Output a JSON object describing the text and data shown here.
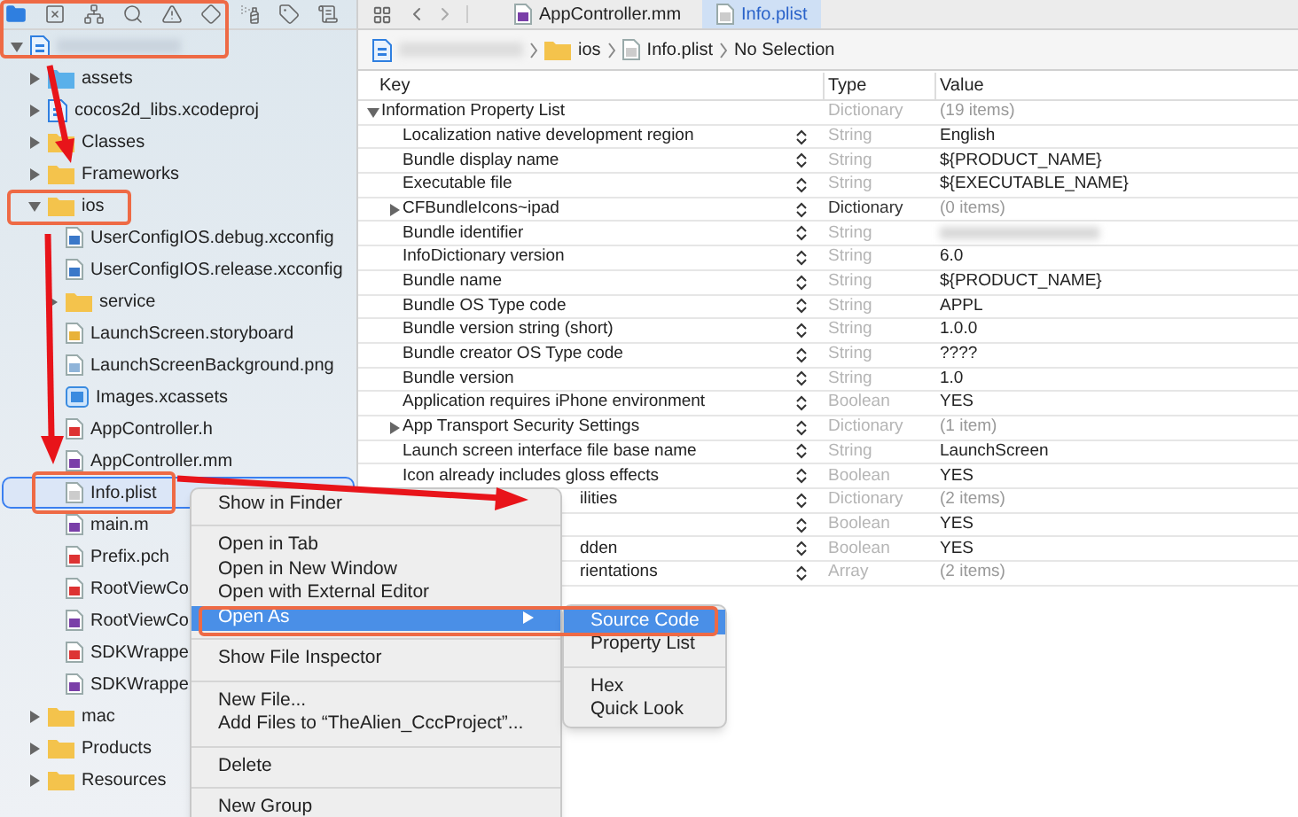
{
  "navigator_tabs": [
    {
      "kind": "folder",
      "selected": true
    },
    {
      "kind": "source-control",
      "selected": false
    },
    {
      "kind": "hierarchy",
      "selected": false
    },
    {
      "kind": "search",
      "selected": false
    },
    {
      "kind": "warning",
      "selected": false
    },
    {
      "kind": "test",
      "selected": false
    },
    {
      "kind": "debug",
      "selected": false
    },
    {
      "kind": "breakpoint",
      "selected": false
    },
    {
      "kind": "report",
      "selected": false
    }
  ],
  "tree": [
    {
      "kind": "project",
      "blurred": true,
      "expanded": true,
      "selected": false,
      "children": [
        {
          "name": "assets",
          "kind": "blue-folder",
          "expanded": false,
          "selected": false
        },
        {
          "name": "cocos2d_libs.xcodeproj",
          "kind": "project",
          "expanded": false,
          "selected": false
        },
        {
          "name": "Classes",
          "kind": "folder",
          "expanded": false,
          "selected": false
        },
        {
          "name": "Frameworks",
          "kind": "folder",
          "expanded": false,
          "selected": false
        },
        {
          "name": "ios",
          "kind": "folder",
          "expanded": true,
          "selected": false,
          "children": [
            {
              "name": "UserConfigIOS.debug.xcconfig",
              "kind": "xcconfig",
              "selected": false
            },
            {
              "name": "UserConfigIOS.release.xcconfig",
              "kind": "xcconfig",
              "selected": false
            },
            {
              "name": "service",
              "kind": "folder",
              "expanded": false,
              "selected": false
            },
            {
              "name": "LaunchScreen.storyboard",
              "kind": "storyboard",
              "selected": false
            },
            {
              "name": "LaunchScreenBackground.png",
              "kind": "png",
              "selected": false
            },
            {
              "name": "Images.xcassets",
              "kind": "xcassets",
              "selected": false
            },
            {
              "name": "AppController.h",
              "kind": "h",
              "selected": false
            },
            {
              "name": "AppController.mm",
              "kind": "m",
              "selected": false
            },
            {
              "name": "Info.plist",
              "kind": "plist",
              "selected": true
            },
            {
              "name": "main.m",
              "kind": "m",
              "selected": false
            },
            {
              "name": "Prefix.pch",
              "kind": "h",
              "selected": false
            },
            {
              "name": "RootViewCo",
              "kind": "h",
              "selected": false
            },
            {
              "name": "RootViewCo",
              "kind": "m",
              "selected": false
            },
            {
              "name": "SDKWrappe",
              "kind": "h",
              "selected": false
            },
            {
              "name": "SDKWrappe",
              "kind": "m",
              "selected": false
            }
          ]
        },
        {
          "name": "mac",
          "kind": "folder",
          "expanded": false,
          "selected": false
        },
        {
          "name": "Products",
          "kind": "folder",
          "expanded": false,
          "selected": false
        },
        {
          "name": "Resources",
          "kind": "folder",
          "expanded": false,
          "selected": false
        }
      ]
    }
  ],
  "editor_tabs": [
    {
      "label": "AppController.mm",
      "kind": "m",
      "selected": false
    },
    {
      "label": "Info.plist",
      "kind": "plist",
      "selected": true
    }
  ],
  "breadcrumb": [
    {
      "kind": "project",
      "blurred": true
    },
    {
      "label": "ios",
      "kind": "folder"
    },
    {
      "label": "Info.plist",
      "kind": "plist"
    },
    {
      "label": "No Selection"
    }
  ],
  "table": {
    "columns": [
      "Key",
      "Type",
      "Value"
    ],
    "rows": [
      {
        "key": "Information Property List",
        "type": "Dictionary",
        "value": "(19 items)",
        "expanded": true,
        "root": true
      },
      {
        "key": "Localization native development region",
        "type": "String",
        "value": "English"
      },
      {
        "key": "Bundle display name",
        "type": "String",
        "value": "${PRODUCT_NAME}"
      },
      {
        "key": "Executable file",
        "type": "String",
        "value": "${EXECUTABLE_NAME}"
      },
      {
        "key": "CFBundleIcons~ipad",
        "type": "Dictionary",
        "value": "(0 items)",
        "expanded": false,
        "type_emphasized": true
      },
      {
        "key": "Bundle identifier",
        "type": "String",
        "value_blurred": true
      },
      {
        "key": "InfoDictionary version",
        "type": "String",
        "value": "6.0"
      },
      {
        "key": "Bundle name",
        "type": "String",
        "value": "${PRODUCT_NAME}"
      },
      {
        "key": "Bundle OS Type code",
        "type": "String",
        "value": "APPL"
      },
      {
        "key": "Bundle version string (short)",
        "type": "String",
        "value": "1.0.0"
      },
      {
        "key": "Bundle creator OS Type code",
        "type": "String",
        "value": "????"
      },
      {
        "key": "Bundle version",
        "type": "String",
        "value": "1.0"
      },
      {
        "key": "Application requires iPhone environment",
        "type": "Boolean",
        "value": "YES"
      },
      {
        "key": "App Transport Security Settings",
        "type": "Dictionary",
        "value": "(1 item)",
        "expanded": false
      },
      {
        "key": "Launch screen interface file base name",
        "type": "String",
        "value": "LaunchScreen"
      },
      {
        "key": "Icon already includes gloss effects",
        "type": "Boolean",
        "value": "YES"
      },
      {
        "key": "ilities",
        "type": "Dictionary",
        "value": "(2 items)",
        "covered": true
      },
      {
        "type": "Boolean",
        "value": "YES",
        "covered": true
      },
      {
        "key": "dden",
        "type": "Boolean",
        "value": "YES",
        "covered": true
      },
      {
        "key": "rientations",
        "type": "Array",
        "value": "(2 items)",
        "covered": true
      }
    ]
  },
  "context_menu": [
    {
      "kind": "item",
      "label": "Show in Finder",
      "selected": false
    },
    {
      "kind": "separator"
    },
    {
      "kind": "item",
      "label": "Open in Tab",
      "selected": false
    },
    {
      "kind": "item",
      "label": "Open in New Window",
      "selected": false
    },
    {
      "kind": "item",
      "label": "Open with External Editor",
      "selected": false
    },
    {
      "kind": "item",
      "label": "Open As",
      "selected": true,
      "submenu": true
    },
    {
      "kind": "separator"
    },
    {
      "kind": "item",
      "label": "Show File Inspector",
      "selected": false
    },
    {
      "kind": "separator"
    },
    {
      "kind": "item",
      "label": "New File...",
      "selected": false
    },
    {
      "kind": "item",
      "label": "Add Files to “TheAlien_CccProject”...",
      "selected": false
    },
    {
      "kind": "separator"
    },
    {
      "kind": "item",
      "label": "Delete",
      "selected": false
    },
    {
      "kind": "separator"
    },
    {
      "kind": "item",
      "label": "New Group",
      "selected": false
    }
  ],
  "submenu": [
    {
      "kind": "item",
      "label": "Source Code",
      "selected": true
    },
    {
      "kind": "item",
      "label": "Property List",
      "selected": false
    },
    {
      "kind": "separator"
    },
    {
      "kind": "item",
      "label": "Hex",
      "selected": false
    },
    {
      "kind": "item",
      "label": "Quick Look",
      "selected": false
    }
  ]
}
